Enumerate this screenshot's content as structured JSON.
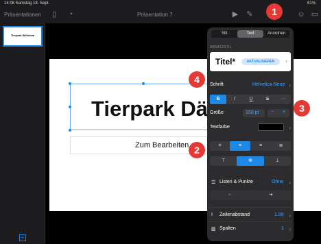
{
  "status_bar": {
    "time_date": "14:08  Samstag 18. Sept.",
    "right": "61%"
  },
  "toolbar": {
    "back_label": "Präsentationen",
    "document_title": "Präsentation 7"
  },
  "navigator": {
    "thumbnail_title": "Tierpark Wilhelma"
  },
  "slide": {
    "title": "Tierpark Dä",
    "subtitle": "Zum Bearbeiten"
  },
  "popover": {
    "tabs": [
      "Stil",
      "Text",
      "Anordnen"
    ],
    "paragraph_style_label": "ABSATZSTIL",
    "paragraph_style_name": "Titel*",
    "update_label": "AKTUALISIEREN",
    "font_label": "Schrift",
    "font_value": "Helvetica Neue",
    "format_buttons": [
      "B",
      "I",
      "U",
      "S",
      "···"
    ],
    "size_label": "Größe",
    "size_value": "150 pt",
    "size_minus": "−",
    "size_plus": "+",
    "text_color_label": "Textfarbe",
    "lists_label": "Listen & Punkte",
    "lists_value": "Ohne",
    "line_spacing_label": "Zeilenabstand",
    "line_spacing_value": "1.00",
    "columns_label": "Spalten",
    "columns_value": "1"
  },
  "callouts": [
    "1",
    "2",
    "3",
    "4"
  ],
  "colors": {
    "accent": "#1e88e5",
    "callout": "#e53935",
    "panel": "#2c2c2e"
  }
}
